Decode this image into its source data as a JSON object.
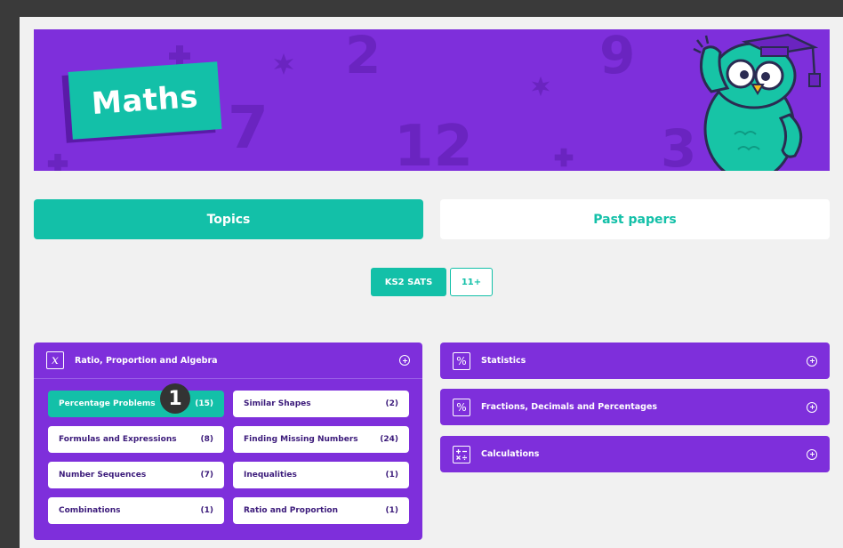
{
  "hero": {
    "title": "Maths",
    "background_glyphs": [
      "2",
      "7",
      "12",
      "9",
      "3"
    ]
  },
  "tabs": {
    "topics_label": "Topics",
    "past_papers_label": "Past papers",
    "active": "Topics"
  },
  "levels": {
    "ks2_label": "KS2 SATS",
    "eleven_plus_label": "11+",
    "active": "KS2 SATS"
  },
  "topics": {
    "ratio": {
      "title": "Ratio, Proportion and Algebra",
      "icon": "variable-x-icon",
      "subtopics": [
        {
          "label": "Percentage Problems",
          "count": "(15)",
          "active": true
        },
        {
          "label": "Similar Shapes",
          "count": "(2)"
        },
        {
          "label": "Formulas and Expressions",
          "count": "(8)"
        },
        {
          "label": "Finding Missing Numbers",
          "count": "(24)"
        },
        {
          "label": "Number Sequences",
          "count": "(7)"
        },
        {
          "label": "Inequalities",
          "count": "(1)"
        },
        {
          "label": "Combinations",
          "count": "(1)"
        },
        {
          "label": "Ratio and Proportion",
          "count": "(1)"
        }
      ]
    },
    "statistics": {
      "title": "Statistics",
      "icon": "percent-icon"
    },
    "fractions": {
      "title": "Fractions, Decimals and Percentages",
      "icon": "percent-icon"
    },
    "calculations": {
      "title": "Calculations",
      "icon": "operators-icon"
    }
  },
  "annotation": {
    "marker": "1"
  },
  "colors": {
    "purple": "#7e2fdb",
    "teal": "#13c0a8",
    "page_bg": "#f1f1f1",
    "outer_bg": "#3a3a3a"
  }
}
